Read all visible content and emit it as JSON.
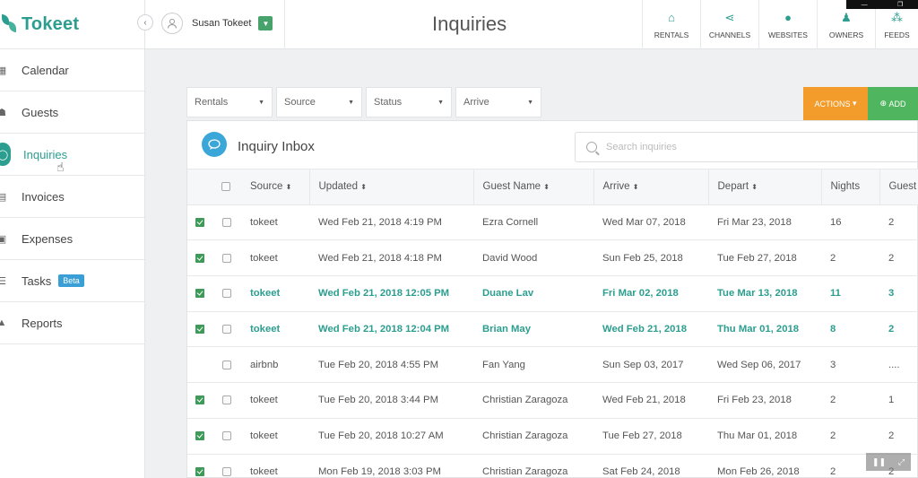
{
  "app": {
    "logo_text": "Tokeet"
  },
  "user": {
    "name": "Susan Tokeet"
  },
  "page_title": "Inquiries",
  "topnav": [
    {
      "label": "RENTALS",
      "icon": "home-icon"
    },
    {
      "label": "CHANNELS",
      "icon": "share-icon"
    },
    {
      "label": "WEBSITES",
      "icon": "globe-icon"
    },
    {
      "label": "OWNERS",
      "icon": "user-icon"
    },
    {
      "label": "FEEDS",
      "icon": "feed-icon"
    }
  ],
  "sidebar": {
    "items": [
      {
        "label": "Calendar",
        "icon": "calendar-icon"
      },
      {
        "label": "Guests",
        "icon": "guests-icon"
      },
      {
        "label": "Inquiries",
        "icon": "chat-icon",
        "active": true
      },
      {
        "label": "Invoices",
        "icon": "invoice-icon"
      },
      {
        "label": "Expenses",
        "icon": "expense-icon"
      },
      {
        "label": "Tasks",
        "icon": "tasks-icon",
        "badge": "Beta"
      },
      {
        "label": "Reports",
        "icon": "reports-icon"
      }
    ]
  },
  "filters": [
    "Rentals",
    "Source",
    "Status",
    "Arrive"
  ],
  "actions_label": "ACTIONS",
  "add_label": "ADD",
  "inbox": {
    "title": "Inquiry Inbox",
    "search_placeholder": "Search inquiries",
    "columns": [
      "Source",
      "Updated",
      "Guest Name",
      "Arrive",
      "Depart",
      "Nights",
      "Guest"
    ],
    "rows": [
      {
        "flag": true,
        "unread": false,
        "source": "tokeet",
        "updated": "Wed Feb 21, 2018 4:19 PM",
        "guest": "Ezra Cornell",
        "arrive": "Wed Mar 07, 2018",
        "depart": "Fri Mar 23, 2018",
        "nights": "16",
        "guests": "2"
      },
      {
        "flag": true,
        "unread": false,
        "source": "tokeet",
        "updated": "Wed Feb 21, 2018 4:18 PM",
        "guest": "David Wood",
        "arrive": "Sun Feb 25, 2018",
        "depart": "Tue Feb 27, 2018",
        "nights": "2",
        "guests": "2"
      },
      {
        "flag": true,
        "unread": true,
        "source": "tokeet",
        "updated": "Wed Feb 21, 2018 12:05 PM",
        "guest": "Duane Lav",
        "arrive": "Fri Mar 02, 2018",
        "depart": "Tue Mar 13, 2018",
        "nights": "11",
        "guests": "3"
      },
      {
        "flag": true,
        "unread": true,
        "source": "tokeet",
        "updated": "Wed Feb 21, 2018 12:04 PM",
        "guest": "Brian May",
        "arrive": "Wed Feb 21, 2018",
        "depart": "Thu Mar 01, 2018",
        "nights": "8",
        "guests": "2"
      },
      {
        "flag": false,
        "unread": false,
        "source": "airbnb",
        "updated": "Tue Feb 20, 2018 4:55 PM",
        "guest": "Fan Yang",
        "arrive": "Sun Sep 03, 2017",
        "depart": "Wed Sep 06, 2017",
        "nights": "3",
        "guests": "...."
      },
      {
        "flag": true,
        "unread": false,
        "source": "tokeet",
        "updated": "Tue Feb 20, 2018 3:44 PM",
        "guest": "Christian Zaragoza",
        "arrive": "Wed Feb 21, 2018",
        "depart": "Fri Feb 23, 2018",
        "nights": "2",
        "guests": "1"
      },
      {
        "flag": true,
        "unread": false,
        "source": "tokeet",
        "updated": "Tue Feb 20, 2018 10:27 AM",
        "guest": "Christian Zaragoza",
        "arrive": "Tue Feb 27, 2018",
        "depart": "Thu Mar 01, 2018",
        "nights": "2",
        "guests": "2"
      },
      {
        "flag": true,
        "unread": false,
        "source": "tokeet",
        "updated": "Mon Feb 19, 2018 3:03 PM",
        "guest": "Christian Zaragoza",
        "arrive": "Sat Feb 24, 2018",
        "depart": "Mon Feb 26, 2018",
        "nights": "2",
        "guests": "2"
      }
    ]
  },
  "colors": {
    "brand": "#2c9e8f",
    "actions": "#f39c2b",
    "add": "#4fb55f",
    "flag": "#3f9a5a"
  }
}
